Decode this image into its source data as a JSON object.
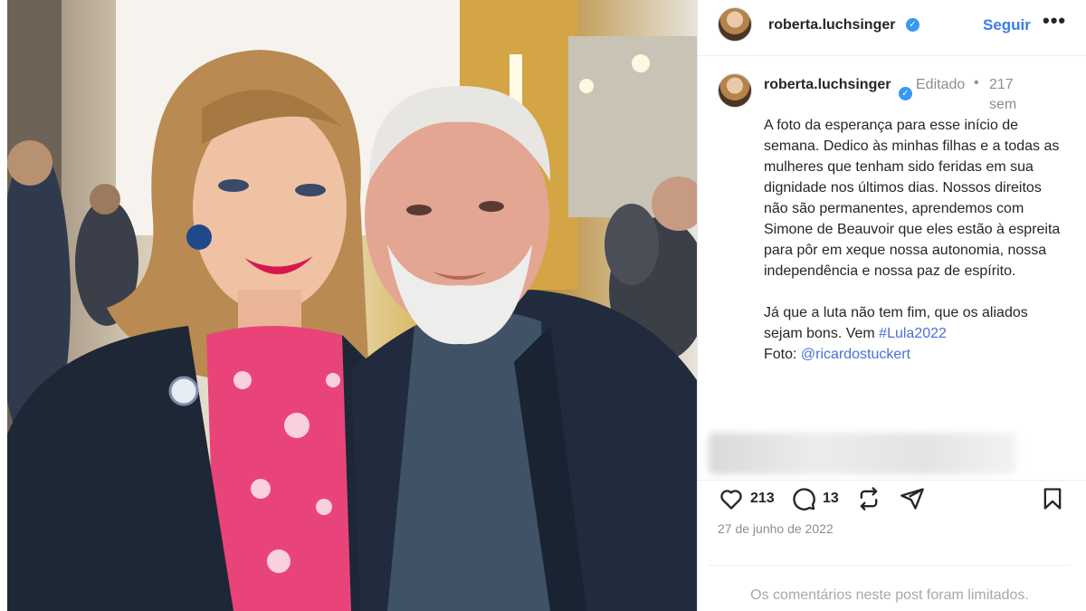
{
  "photo": {
    "description_icon": "photo-of-two-people-icon",
    "colors": {
      "jacket": "#1c2533",
      "blouse": "#e9447a",
      "background_gold": "#d2a84a"
    }
  },
  "header": {
    "username": "roberta.luchsinger",
    "verified_icon": "verified-badge-icon",
    "follow_label": "Seguir",
    "more_label": "•••"
  },
  "caption": {
    "username": "roberta.luchsinger",
    "edited": "Editado",
    "separator": "•",
    "age": "217 sem",
    "paragraph1": "A foto da esperança para esse início de semana. Dedico às minhas filhas e a todas as mulheres que tenham sido feridas em sua dignidade nos últimos dias. Nossos direitos não são permanentes, aprendemos com Simone de Beauvoir que eles estão à espreita para pôr em xeque nossa autonomia, nossa independência e nossa paz de espírito.",
    "paragraph2_text": "Já que a luta não tem fim, que os aliados sejam bons. Vem ",
    "hashtag": "#Lula2022",
    "photo_credit_label": "Foto: ",
    "mention": "@ricardostuckert"
  },
  "actions": {
    "like_count": "213",
    "comment_count": "13",
    "icons": [
      "heart-icon",
      "comment-icon",
      "repost-icon",
      "share-icon",
      "bookmark-icon"
    ]
  },
  "date": "27 de junho de 2022",
  "comments_limited": "Os comentários neste post foram limitados.",
  "colors": {
    "accent": "#3b7de9",
    "link": "#4a6fd8",
    "muted": "#8e8e8e",
    "verified": "#3897f0"
  }
}
